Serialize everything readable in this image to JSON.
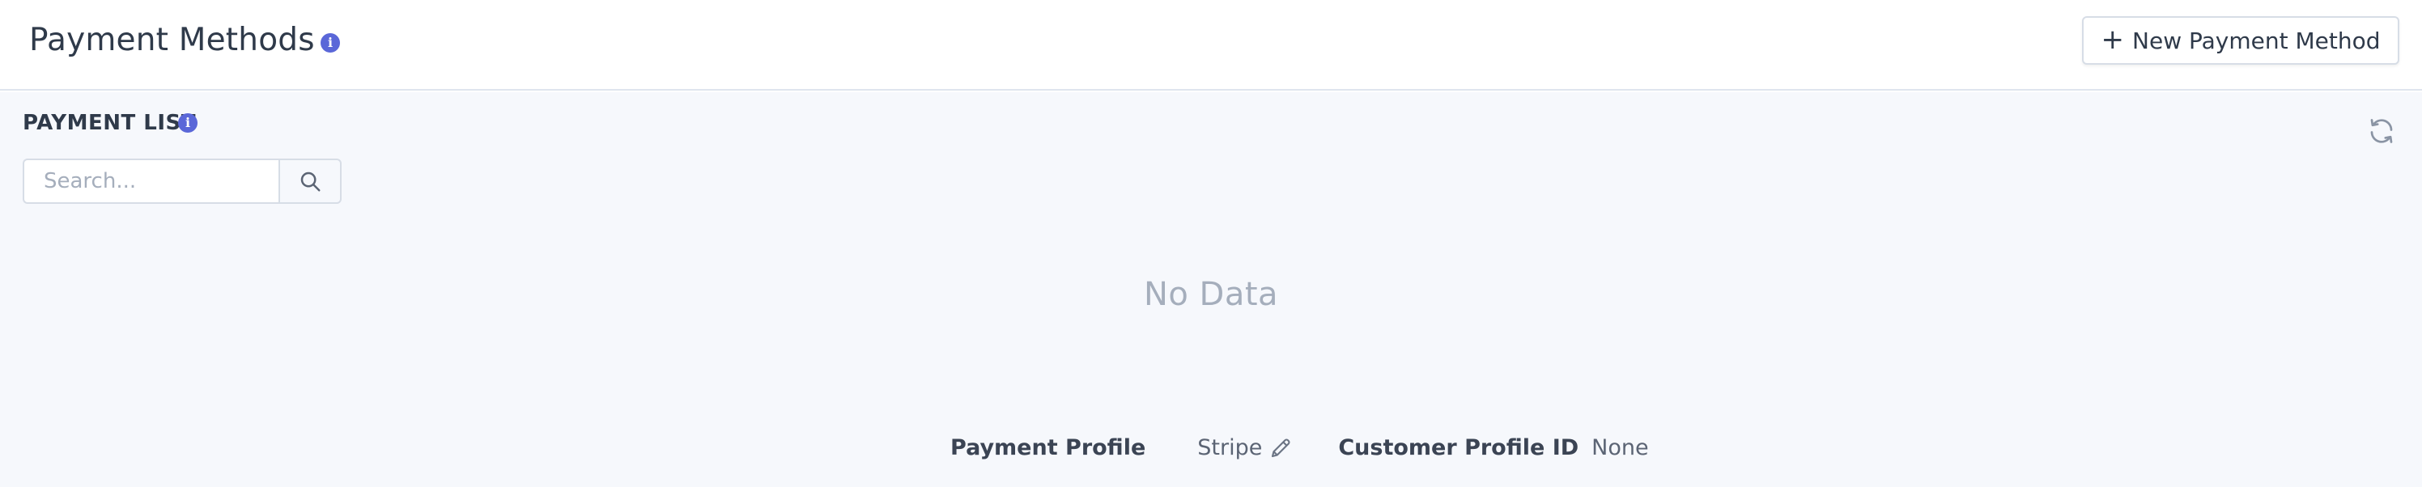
{
  "header": {
    "title": "Payment Methods",
    "title_info_icon": "info-icon",
    "new_button_plus": "+",
    "new_button_label": "New Payment Method"
  },
  "list": {
    "title": "PAYMENT LIST",
    "info_icon": "info-icon",
    "refresh_icon": "refresh-icon",
    "search_placeholder": "Search...",
    "search_value": "",
    "search_icon": "search-icon",
    "empty_text": "No Data"
  },
  "footer": {
    "payment_profile_label": "Payment Profile",
    "payment_profile_value": "Stripe",
    "edit_icon": "pencil-icon",
    "customer_profile_label": "Customer Profile ID",
    "customer_profile_value": "None"
  },
  "colors": {
    "accent": "#5a67d8",
    "content_bg": "#f6f8fc",
    "muted_text": "#a5aebc"
  }
}
